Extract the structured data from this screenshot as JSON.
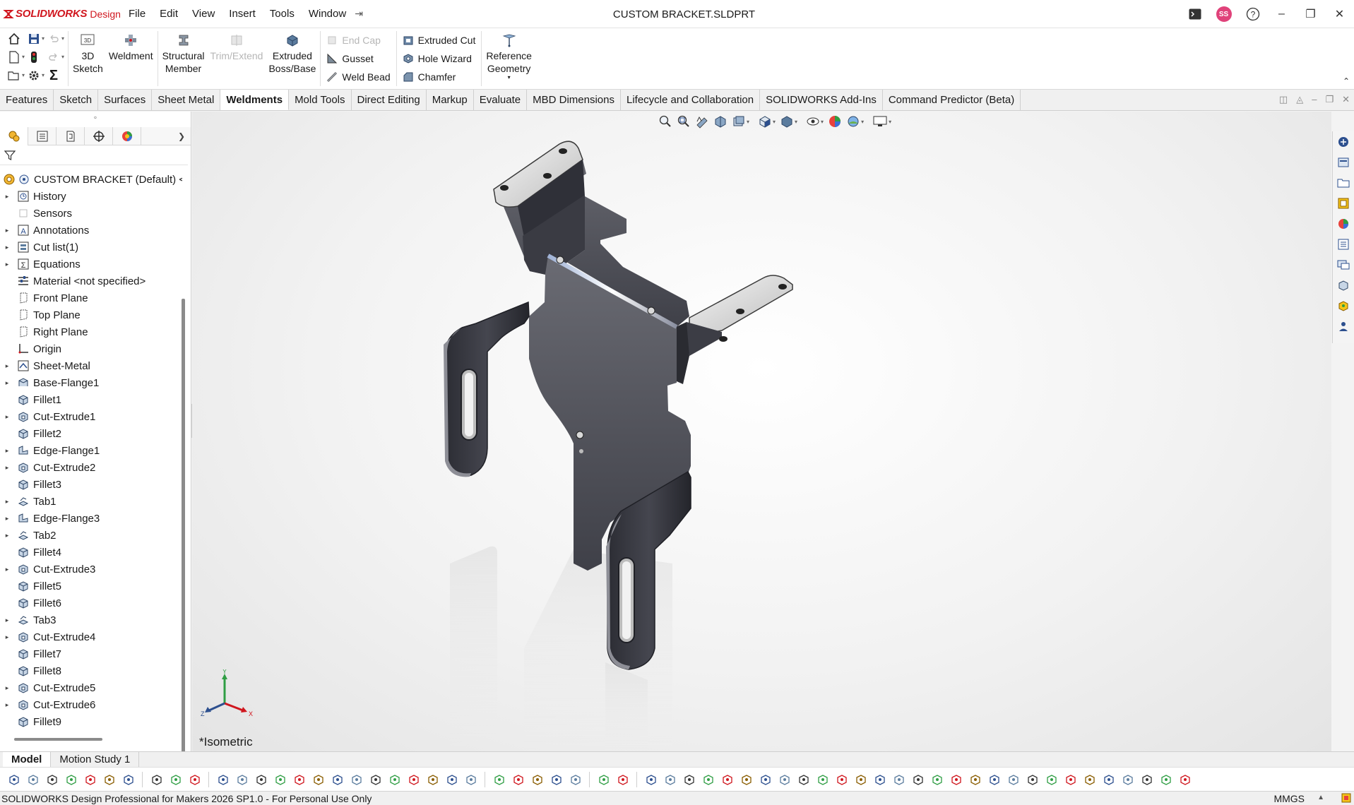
{
  "app": {
    "brand_bold": "SOLIDWORKS",
    "brand_light": "Design",
    "document_title": "CUSTOM BRACKET.SLDPRT",
    "user_initials": "SS",
    "accent_color": "#d0161e"
  },
  "menu": [
    "File",
    "Edit",
    "View",
    "Insert",
    "Tools",
    "Window"
  ],
  "ribbon": {
    "sketch3d": "3D\nSketch",
    "weldment": "Weldment",
    "structural_member": "Structural\nMember",
    "trim_extend": "Trim/Extend",
    "extruded_boss": "Extruded\nBoss/Base",
    "end_cap": "End Cap",
    "gusset": "Gusset",
    "weld_bead": "Weld Bead",
    "extruded_cut": "Extruded Cut",
    "hole_wizard": "Hole Wizard",
    "chamfer": "Chamfer",
    "reference_geometry": "Reference\nGeometry"
  },
  "tabs": [
    {
      "label": "Features",
      "active": false
    },
    {
      "label": "Sketch",
      "active": false
    },
    {
      "label": "Surfaces",
      "active": false
    },
    {
      "label": "Sheet Metal",
      "active": false
    },
    {
      "label": "Weldments",
      "active": true
    },
    {
      "label": "Mold Tools",
      "active": false
    },
    {
      "label": "Direct Editing",
      "active": false
    },
    {
      "label": "Markup",
      "active": false
    },
    {
      "label": "Evaluate",
      "active": false
    },
    {
      "label": "MBD Dimensions",
      "active": false
    },
    {
      "label": "Lifecycle and Collaboration",
      "active": false
    },
    {
      "label": "SOLIDWORKS Add-Ins",
      "active": false
    },
    {
      "label": "Command Predictor (Beta)",
      "active": false
    }
  ],
  "tree": {
    "root": "CUSTOM BRACKET  (Default) <<",
    "items": [
      {
        "label": "History",
        "icon": "history-icon",
        "expandable": true
      },
      {
        "label": "Sensors",
        "icon": "sensors-icon",
        "expandable": false
      },
      {
        "label": "Annotations",
        "icon": "annotations-icon",
        "expandable": true
      },
      {
        "label": "Cut list(1)",
        "icon": "cut-list-icon",
        "expandable": true
      },
      {
        "label": "Equations",
        "icon": "equations-icon",
        "expandable": true
      },
      {
        "label": "Material <not specified>",
        "icon": "material-icon",
        "expandable": false
      },
      {
        "label": "Front Plane",
        "icon": "plane-icon",
        "expandable": false
      },
      {
        "label": "Top Plane",
        "icon": "plane-icon",
        "expandable": false
      },
      {
        "label": "Right Plane",
        "icon": "plane-icon",
        "expandable": false
      },
      {
        "label": "Origin",
        "icon": "origin-icon",
        "expandable": false
      },
      {
        "label": "Sheet-Metal",
        "icon": "sheet-metal-icon",
        "expandable": true
      },
      {
        "label": "Base-Flange1",
        "icon": "base-flange-icon",
        "expandable": true
      },
      {
        "label": "Fillet1",
        "icon": "fillet-icon",
        "expandable": false
      },
      {
        "label": "Cut-Extrude1",
        "icon": "cut-extrude-icon",
        "expandable": true
      },
      {
        "label": "Fillet2",
        "icon": "fillet-icon",
        "expandable": false
      },
      {
        "label": "Edge-Flange1",
        "icon": "edge-flange-icon",
        "expandable": true
      },
      {
        "label": "Cut-Extrude2",
        "icon": "cut-extrude-icon",
        "expandable": true
      },
      {
        "label": "Fillet3",
        "icon": "fillet-icon",
        "expandable": false
      },
      {
        "label": "Tab1",
        "icon": "tab-icon",
        "expandable": true
      },
      {
        "label": "Edge-Flange3",
        "icon": "edge-flange-icon",
        "expandable": true
      },
      {
        "label": "Tab2",
        "icon": "tab-icon",
        "expandable": true
      },
      {
        "label": "Fillet4",
        "icon": "fillet-icon",
        "expandable": false
      },
      {
        "label": "Cut-Extrude3",
        "icon": "cut-extrude-icon",
        "expandable": true
      },
      {
        "label": "Fillet5",
        "icon": "fillet-icon",
        "expandable": false
      },
      {
        "label": "Fillet6",
        "icon": "fillet-icon",
        "expandable": false
      },
      {
        "label": "Tab3",
        "icon": "tab-icon",
        "expandable": true
      },
      {
        "label": "Cut-Extrude4",
        "icon": "cut-extrude-icon",
        "expandable": true
      },
      {
        "label": "Fillet7",
        "icon": "fillet-icon",
        "expandable": false
      },
      {
        "label": "Fillet8",
        "icon": "fillet-icon",
        "expandable": false
      },
      {
        "label": "Cut-Extrude5",
        "icon": "cut-extrude-icon",
        "expandable": true
      },
      {
        "label": "Cut-Extrude6",
        "icon": "cut-extrude-icon",
        "expandable": true
      },
      {
        "label": "Fillet9",
        "icon": "fillet-icon",
        "expandable": false
      }
    ]
  },
  "viewport": {
    "view_orientation": "*Isometric",
    "triad": {
      "x": "X",
      "y": "Y",
      "z": "Z"
    }
  },
  "bottom_tabs": [
    {
      "label": "Model",
      "active": true
    },
    {
      "label": "Motion Study 1",
      "active": false
    }
  ],
  "status": {
    "left": "SOLIDWORKS Design Professional for Makers 2026 SP1.0 - For Personal Use Only",
    "units": "MMGS"
  }
}
